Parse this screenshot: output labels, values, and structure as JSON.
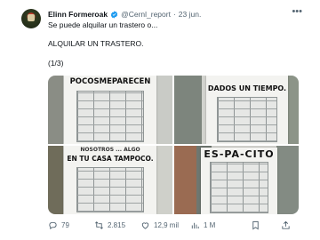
{
  "tweet": {
    "author_name": "Elinn Formeroak",
    "handle": "@Cernl_report",
    "separator": "·",
    "date": "23 jun.",
    "lines": [
      "Se puede alquilar un trastero o...",
      "ALQUILAR UN TRASTERO.",
      "(1/3)"
    ]
  },
  "media": {
    "posters": [
      {
        "text": "POCOSMEPARECEN"
      },
      {
        "text": "DADOS UN TIEMPO."
      },
      {
        "text_top": "NOSOTROS ... ALGO",
        "text_bottom": "EN TU CASA TAMPOCO."
      },
      {
        "text": "ES-PA-CITO"
      }
    ]
  },
  "actions": {
    "replies": "79",
    "retweets": "2.815",
    "likes": "12,9 mil",
    "views": "1 M"
  },
  "icons": {
    "more": "more-icon",
    "verified": "verified-badge-icon",
    "reply": "reply-icon",
    "retweet": "retweet-icon",
    "like": "heart-icon",
    "views": "views-icon",
    "bookmark": "bookmark-icon",
    "share": "share-icon"
  },
  "colors": {
    "verified": "#1d9bf0",
    "muted": "#536471",
    "text": "#0f1419"
  }
}
